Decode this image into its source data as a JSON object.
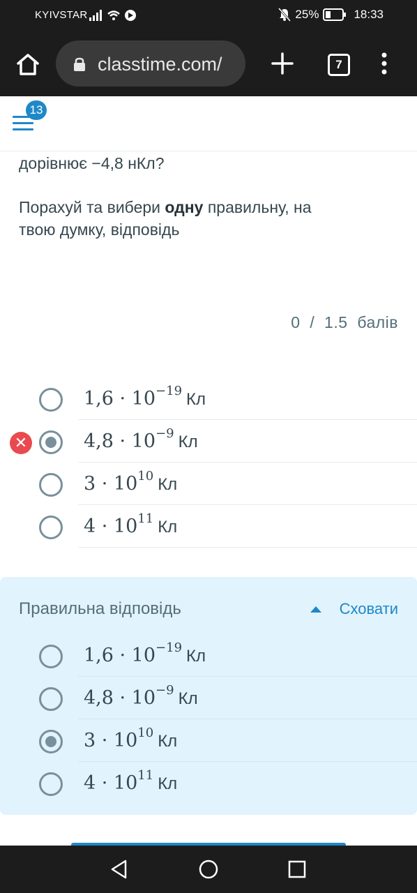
{
  "status": {
    "carrier": "KYIVSTAR",
    "battery": "25%",
    "time": "18:33"
  },
  "browser": {
    "url": "classtime.com/",
    "tab_count": "7"
  },
  "header": {
    "notification_count": "13"
  },
  "question": {
    "text_fragment": "дорівнює −4,8 нКл?",
    "instruction_pre": "Порахуй та вибери ",
    "instruction_bold": "одну",
    "instruction_post": " правильну, на",
    "instruction_line2": "твою думку, відповідь"
  },
  "score": {
    "earned": "0",
    "separator": "/",
    "max": "1.5",
    "unit": "балів"
  },
  "options": [
    {
      "base": "1,6 · 10",
      "exp": "−19",
      "unit": "Кл"
    },
    {
      "base": "4,8 · 10",
      "exp": "−9",
      "unit": "Кл"
    },
    {
      "base": "3 · 10",
      "exp": "10",
      "unit": "Кл"
    },
    {
      "base": "4 · 10",
      "exp": "11",
      "unit": "Кл"
    }
  ],
  "selected_index": 1,
  "correct_panel": {
    "title": "Правильна відповідь",
    "hide_label": "Сховати",
    "correct_index": 2
  },
  "colors": {
    "accent": "#1e88c8",
    "error": "#e84a4f",
    "panel_bg": "#e1f3fc"
  }
}
